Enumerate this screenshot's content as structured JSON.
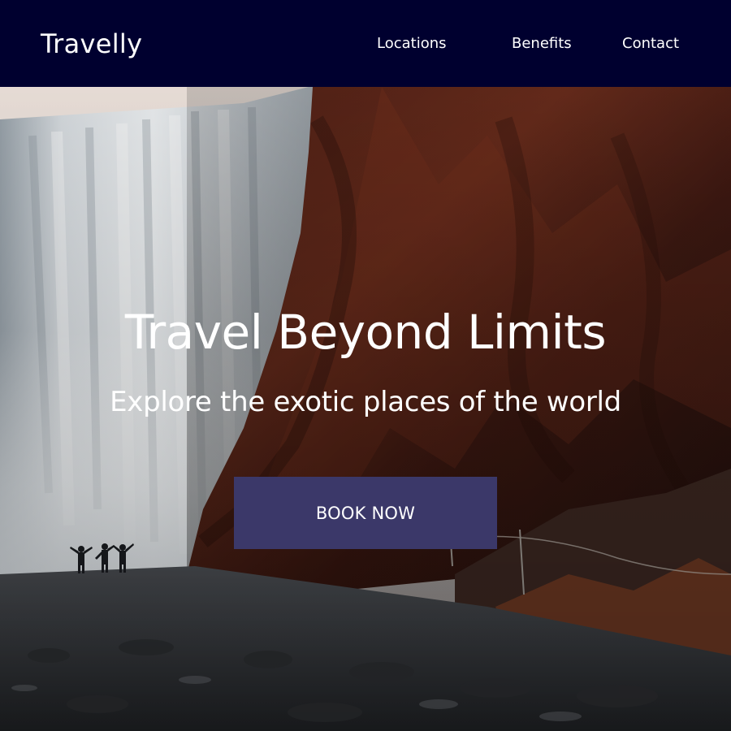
{
  "header": {
    "brand": "Travelly",
    "nav": {
      "locations": "Locations",
      "benefits": "Benefits",
      "contact": "Contact"
    }
  },
  "hero": {
    "title": "Travel Beyond Limits",
    "subtitle": "Explore the exotic places of the world",
    "cta_label": "BOOK NOW"
  },
  "colors": {
    "header_bg": "#00002f",
    "cta_bg": "#3b3869",
    "text": "#ffffff"
  }
}
